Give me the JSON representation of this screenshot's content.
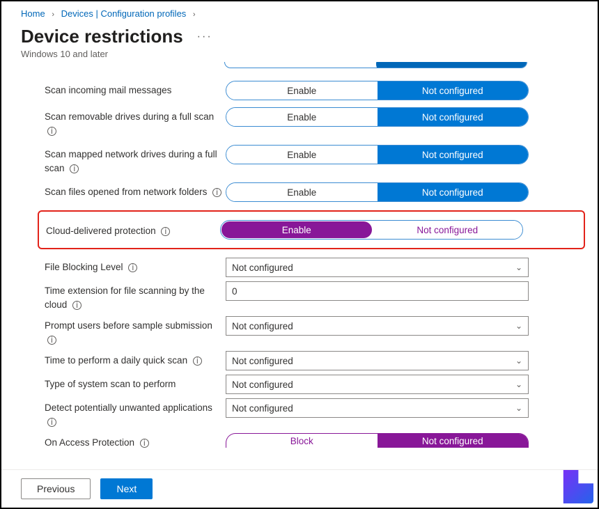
{
  "breadcrumb": {
    "home": "Home",
    "devices": "Devices | Configuration profiles"
  },
  "page": {
    "title": "Device restrictions",
    "subtitle": "Windows 10 and later"
  },
  "toggle_labels": {
    "enable": "Enable",
    "not_configured": "Not configured",
    "block": "Block"
  },
  "settings": [
    {
      "label": "Scan incoming mail messages",
      "info": false,
      "type": "blue"
    },
    {
      "label": "Scan removable drives during a full scan",
      "info": true,
      "type": "blue"
    },
    {
      "label": "Scan mapped network drives during a full scan",
      "info": true,
      "type": "blue"
    },
    {
      "label": "Scan files opened from network folders",
      "info": true,
      "type": "blue"
    },
    {
      "label": "Cloud-delivered protection",
      "info": true,
      "type": "purple_left_highlight"
    },
    {
      "label": "File Blocking Level",
      "info": true,
      "type": "select",
      "value": "Not configured"
    },
    {
      "label": "Time extension for file scanning by the cloud",
      "info": true,
      "type": "input",
      "value": "0"
    },
    {
      "label": "Prompt users before sample submission",
      "info": true,
      "type": "select",
      "value": "Not configured"
    },
    {
      "label": "Time to perform a daily quick scan",
      "info": true,
      "type": "select",
      "value": "Not configured"
    },
    {
      "label": "Type of system scan to perform",
      "info": false,
      "type": "select",
      "value": "Not configured"
    },
    {
      "label": "Detect potentially unwanted applications",
      "info": true,
      "type": "select",
      "value": "Not configured"
    },
    {
      "label": "On Access Protection",
      "info": true,
      "type": "purple_right_trunc"
    }
  ],
  "buttons": {
    "previous": "Previous",
    "next": "Next"
  }
}
